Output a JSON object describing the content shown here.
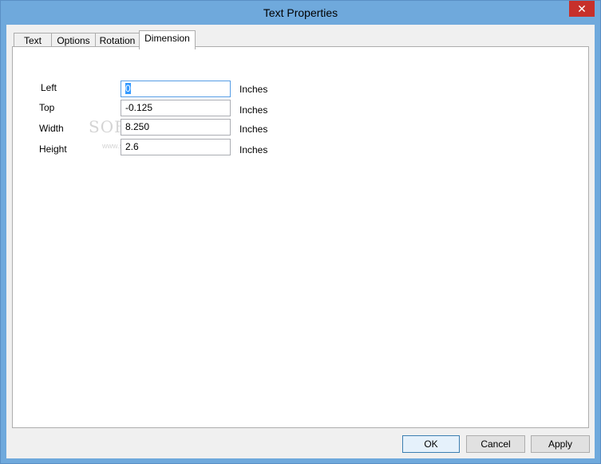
{
  "window": {
    "title": "Text Properties",
    "close_glyph": "✕"
  },
  "tabs": [
    {
      "label": "Text"
    },
    {
      "label": "Options"
    },
    {
      "label": "Rotation"
    },
    {
      "label": "Dimension",
      "active": true
    }
  ],
  "dimension": {
    "left": {
      "label": "Left",
      "value": "0",
      "unit": "Inches"
    },
    "top": {
      "label": "Top",
      "value": "-0.125",
      "unit": "Inches"
    },
    "width": {
      "label": "Width",
      "value": "8.250",
      "unit": "Inches"
    },
    "height": {
      "label": "Height",
      "value": "2.6",
      "unit": "Inches"
    }
  },
  "watermark": {
    "text": "SOFTPEDIA",
    "sub": "www.softpedia.com"
  },
  "buttons": {
    "ok": "OK",
    "cancel": "Cancel",
    "apply": "Apply"
  },
  "colors": {
    "title_bar": "#6fa9dc",
    "close_button": "#c7302b",
    "focus_border": "#569de5",
    "selection": "#3399ff"
  }
}
